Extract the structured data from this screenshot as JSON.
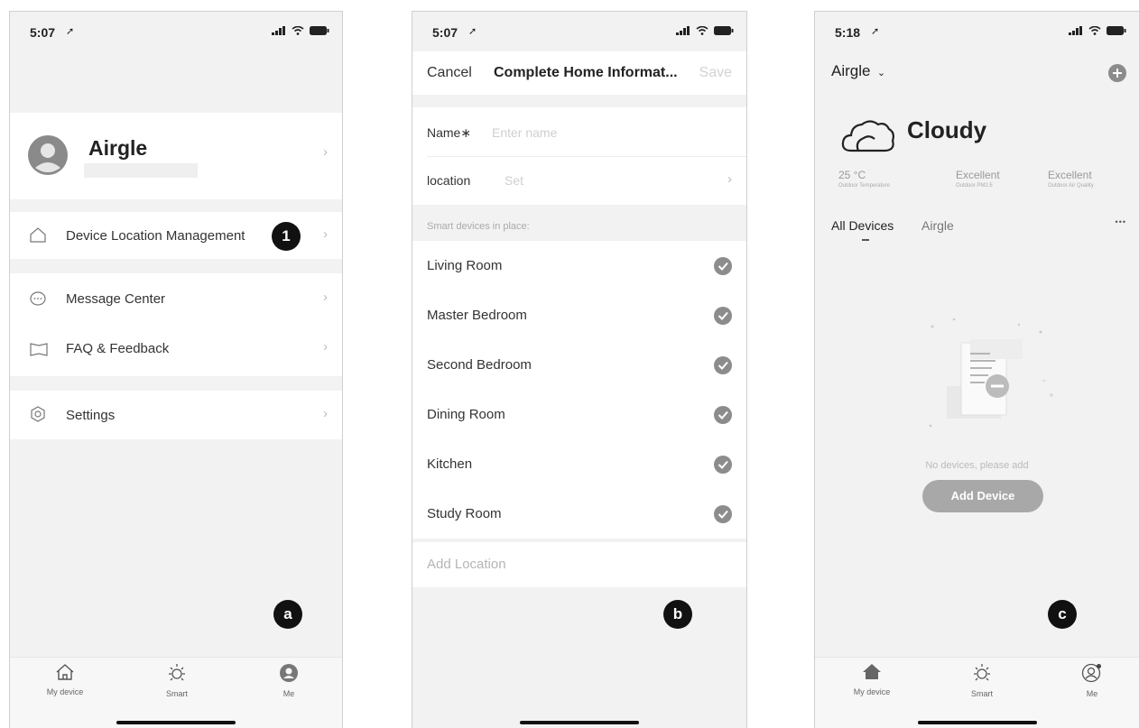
{
  "screen_a": {
    "time": "5:07",
    "profile_name": "Airgle",
    "menu": [
      {
        "label": "Device Location Management"
      },
      {
        "label": "Message Center"
      },
      {
        "label": "FAQ & Feedback"
      },
      {
        "label": "Settings"
      }
    ],
    "callout": "1",
    "screen_badge": "a",
    "tabs": [
      {
        "label": "My device"
      },
      {
        "label": "Smart"
      },
      {
        "label": "Me"
      }
    ]
  },
  "screen_b": {
    "time": "5:07",
    "cancel": "Cancel",
    "title": "Complete Home Informat...",
    "save": "Save",
    "name_label": "Name∗",
    "name_placeholder": "Enter name",
    "location_label": "location",
    "location_value": "Set",
    "section_header": "Smart devices in place:",
    "rooms": [
      {
        "label": "Living Room"
      },
      {
        "label": "Master Bedroom"
      },
      {
        "label": "Second Bedroom"
      },
      {
        "label": "Dining Room"
      },
      {
        "label": "Kitchen"
      },
      {
        "label": "Study Room"
      }
    ],
    "add_location": "Add Location",
    "screen_badge": "b"
  },
  "screen_c": {
    "time": "5:18",
    "home_name": "Airgle",
    "weather": "Cloudy",
    "stats": [
      {
        "value": "25 °C",
        "label": "Outdoor Temperature"
      },
      {
        "value": "Excellent",
        "label": "Outdoor PM2.5"
      },
      {
        "value": "Excellent",
        "label": "Outdoor Air Quality"
      }
    ],
    "tabs_devices": [
      {
        "label": "All Devices"
      },
      {
        "label": "Airgle"
      }
    ],
    "more": "•••",
    "empty_text": "No devices, please add",
    "add_device": "Add Device",
    "screen_badge": "c",
    "tabs": [
      {
        "label": "My device"
      },
      {
        "label": "Smart"
      },
      {
        "label": "Me"
      }
    ]
  }
}
